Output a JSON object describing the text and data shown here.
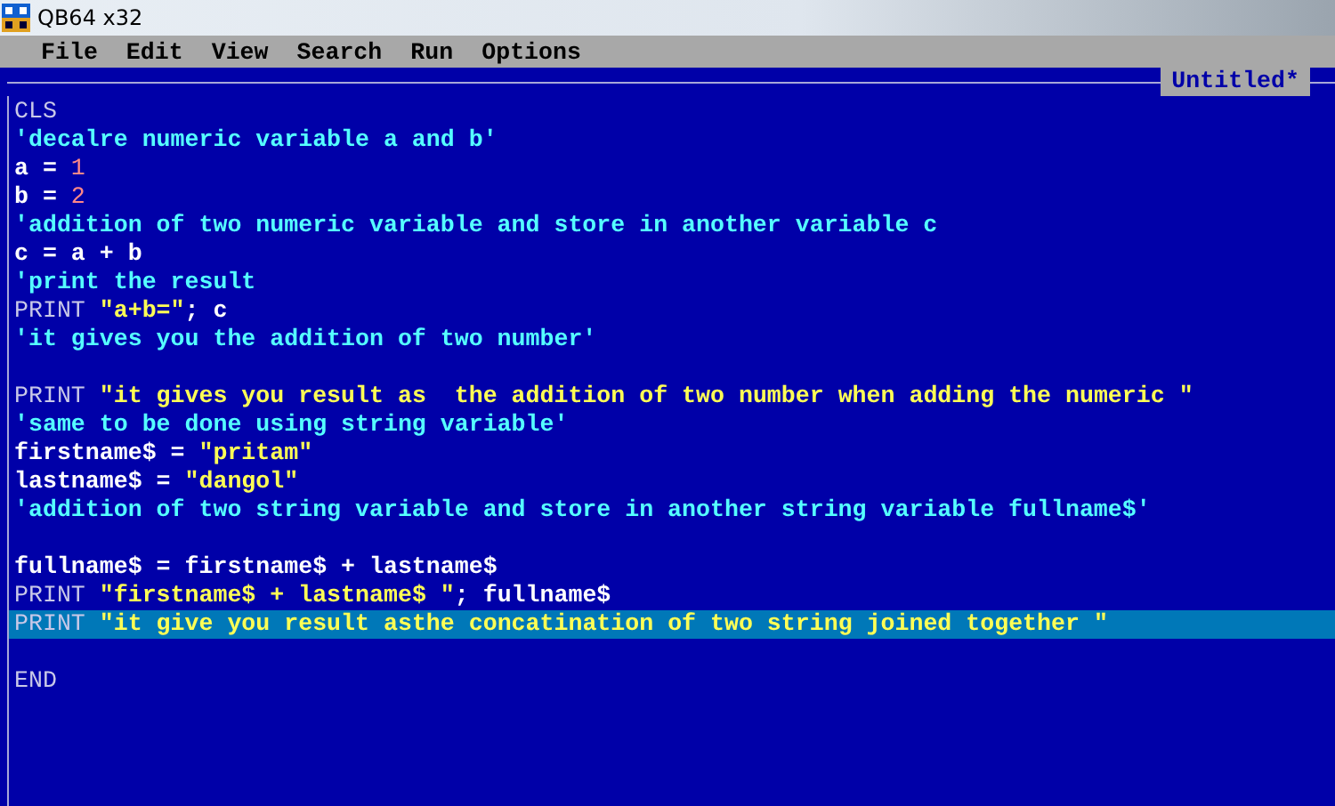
{
  "window": {
    "title": "QB64 x32"
  },
  "menu": [
    "File",
    "Edit",
    "View",
    "Search",
    "Run",
    "Options"
  ],
  "editor": {
    "tab": "Untitled*",
    "lines": [
      {
        "selected": false,
        "segments": [
          {
            "kind": "keyword",
            "text": "CLS"
          }
        ]
      },
      {
        "selected": false,
        "segments": [
          {
            "kind": "comment",
            "text": "'decalre numeric variable a and b'"
          }
        ]
      },
      {
        "selected": false,
        "segments": [
          {
            "kind": "plain",
            "text": "a = "
          },
          {
            "kind": "number",
            "text": "1"
          }
        ]
      },
      {
        "selected": false,
        "segments": [
          {
            "kind": "plain",
            "text": "b = "
          },
          {
            "kind": "number",
            "text": "2"
          }
        ]
      },
      {
        "selected": false,
        "segments": [
          {
            "kind": "comment",
            "text": "'addition of two numeric variable and store in another variable c"
          }
        ]
      },
      {
        "selected": false,
        "segments": [
          {
            "kind": "plain",
            "text": "c = a + b"
          }
        ]
      },
      {
        "selected": false,
        "segments": [
          {
            "kind": "comment",
            "text": "'print the result"
          }
        ]
      },
      {
        "selected": false,
        "segments": [
          {
            "kind": "keyword",
            "text": "PRINT "
          },
          {
            "kind": "string",
            "text": "\"a+b=\""
          },
          {
            "kind": "plain",
            "text": "; c"
          }
        ]
      },
      {
        "selected": false,
        "segments": [
          {
            "kind": "comment",
            "text": "'it gives you the addition of two number'"
          }
        ]
      },
      {
        "selected": false
      },
      {
        "selected": false,
        "segments": [
          {
            "kind": "keyword",
            "text": "PRINT "
          },
          {
            "kind": "string",
            "text": "\"it gives you result as  the addition of two number when adding the numeric \""
          }
        ]
      },
      {
        "selected": false,
        "segments": [
          {
            "kind": "comment",
            "text": "'same to be done using string variable'"
          }
        ]
      },
      {
        "selected": false,
        "segments": [
          {
            "kind": "plain",
            "text": "firstname$ = "
          },
          {
            "kind": "string",
            "text": "\"pritam\""
          }
        ]
      },
      {
        "selected": false,
        "segments": [
          {
            "kind": "plain",
            "text": "lastname$ = "
          },
          {
            "kind": "string",
            "text": "\"dangol\""
          }
        ]
      },
      {
        "selected": false,
        "segments": [
          {
            "kind": "comment",
            "text": "'addition of two string variable and store in another string variable fullname$'"
          }
        ]
      },
      {
        "selected": false
      },
      {
        "selected": false,
        "segments": [
          {
            "kind": "plain",
            "text": "fullname$ = firstname$ + lastname$"
          }
        ]
      },
      {
        "selected": false,
        "segments": [
          {
            "kind": "keyword",
            "text": "PRINT "
          },
          {
            "kind": "string",
            "text": "\"firstname$ + lastname$ \""
          },
          {
            "kind": "plain",
            "text": "; fullname$"
          }
        ]
      },
      {
        "selected": true,
        "segments": [
          {
            "kind": "keyword",
            "text": "PRINT "
          },
          {
            "kind": "string",
            "text": "\"it give you result asthe concatination of two string joined together \""
          }
        ]
      },
      {
        "selected": false
      },
      {
        "selected": false,
        "segments": [
          {
            "kind": "keyword",
            "text": "END"
          }
        ]
      }
    ]
  }
}
